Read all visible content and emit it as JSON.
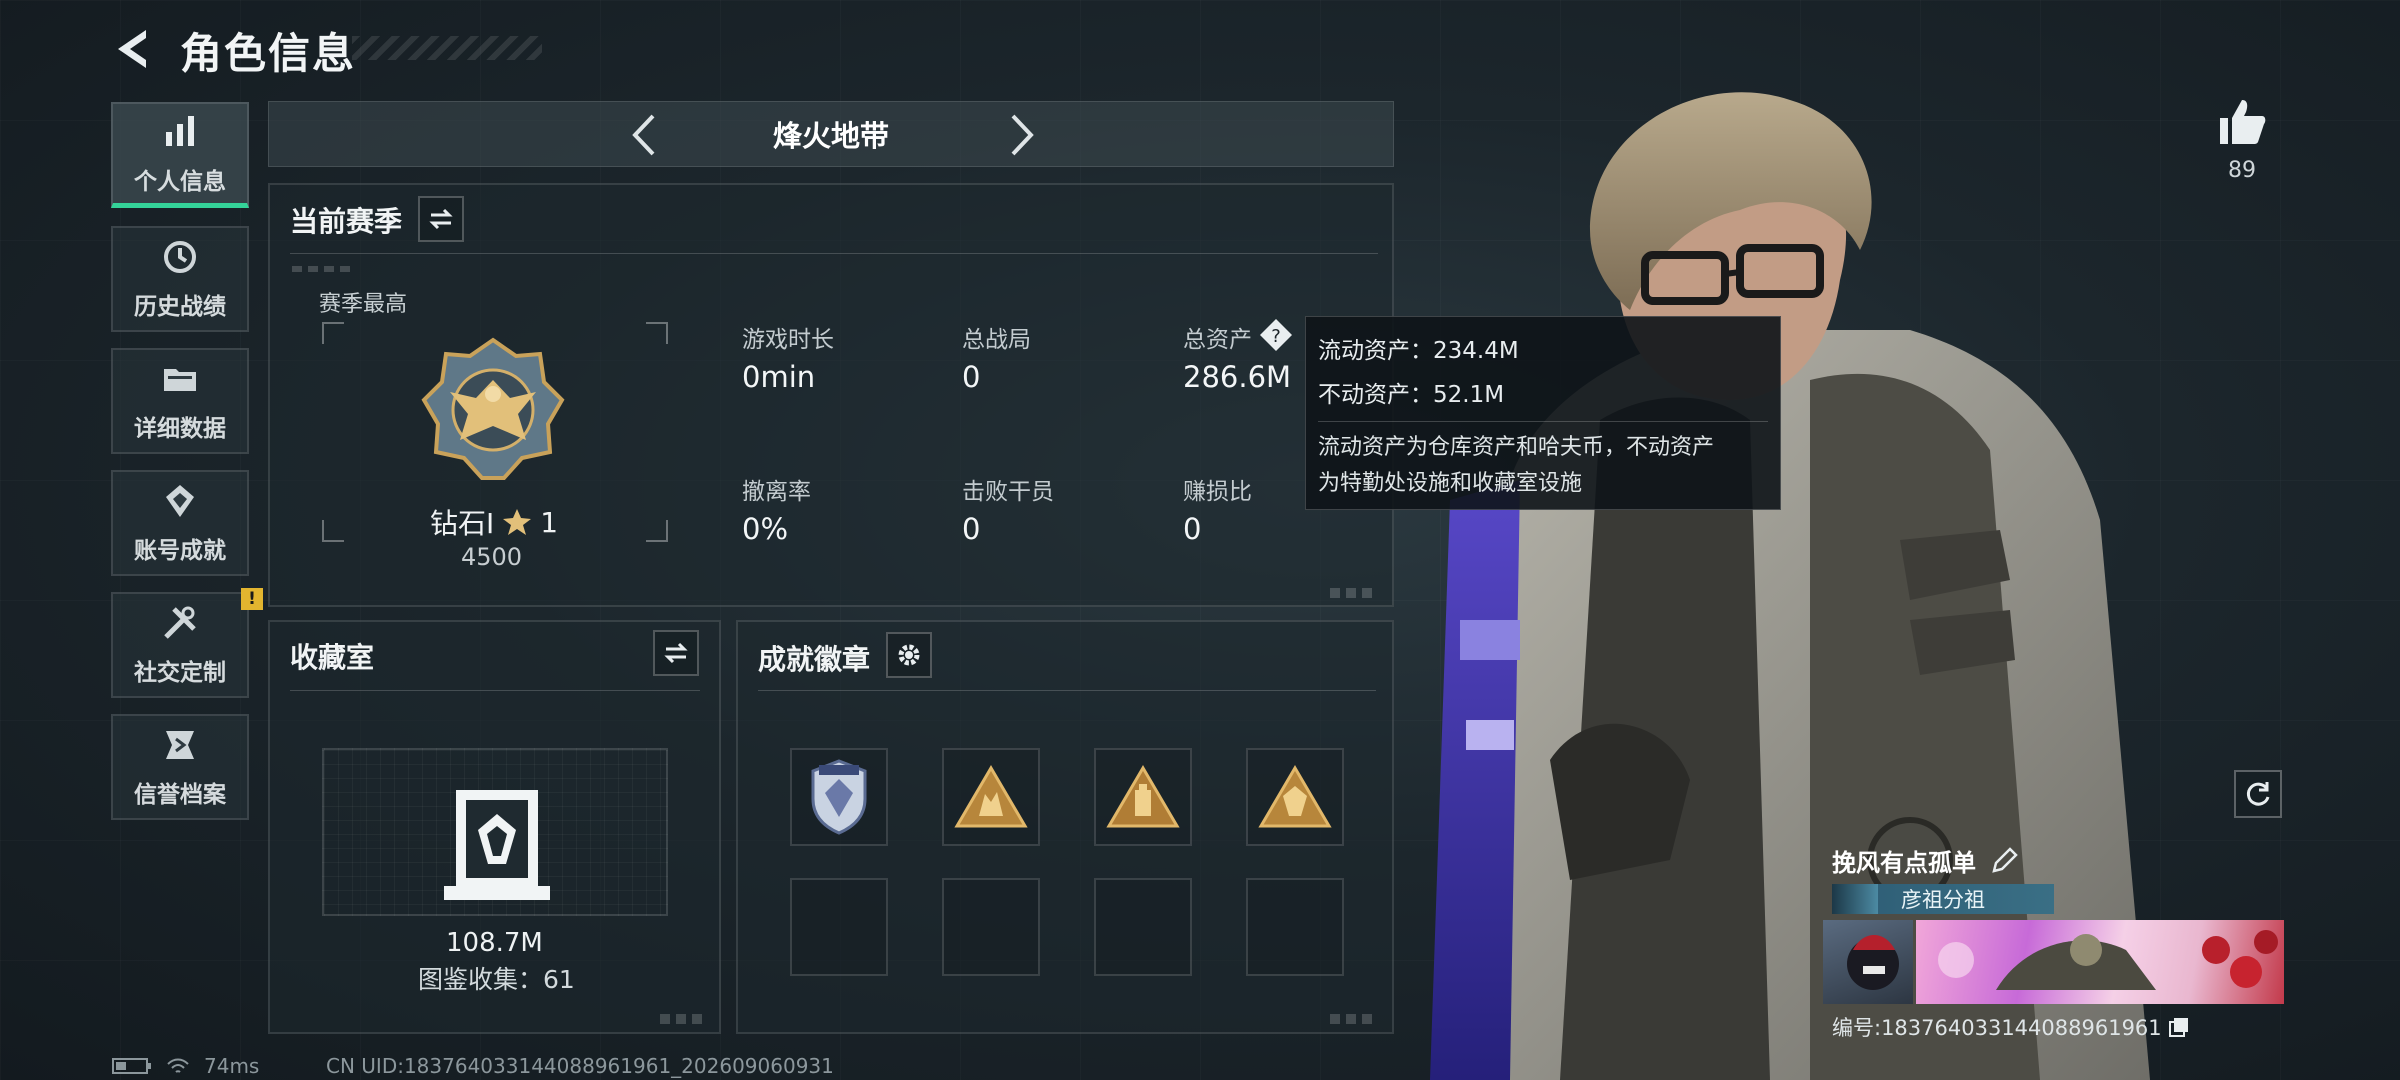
{
  "header": {
    "title": "角色信息"
  },
  "sidebar": {
    "items": [
      {
        "label": "个人信息",
        "icon": "bar-chart-icon",
        "active": true
      },
      {
        "label": "历史战绩",
        "icon": "history-icon"
      },
      {
        "label": "详细数据",
        "icon": "folder-icon"
      },
      {
        "label": "账号成就",
        "icon": "achievement-icon"
      },
      {
        "label": "社交定制",
        "icon": "tools-icon",
        "badge": "!"
      },
      {
        "label": "信誉档案",
        "icon": "credit-icon"
      }
    ]
  },
  "mode": {
    "name": "烽火地带"
  },
  "season": {
    "title": "当前赛季",
    "best_label": "赛季最高",
    "rank": "钻石Ⅰ",
    "stars": "1",
    "score": "4500",
    "stats": [
      {
        "label": "游戏时长",
        "value": "0min"
      },
      {
        "label": "总战局",
        "value": "0"
      },
      {
        "label": "总资产",
        "value": "286.6M"
      },
      {
        "label": "撤离率",
        "value": "0%"
      },
      {
        "label": "击败干员",
        "value": "0"
      },
      {
        "label": "赚损比",
        "value": "0"
      }
    ]
  },
  "tooltip": {
    "liquid": "流动资产：234.4M",
    "fixed": "不动资产：52.1M",
    "desc_line1": "流动资产为仓库资产和哈夫币，不动资产",
    "desc_line2": "为特勤处设施和收藏室设施"
  },
  "collection": {
    "title": "收藏室",
    "value": "108.7M",
    "count": "图鉴收集：61"
  },
  "achievements": {
    "title": "成就徽章"
  },
  "profile": {
    "likes": "89",
    "name": "挽风有点孤单",
    "team": "彦祖分祖",
    "id": "编号:1837640331440889619​61"
  },
  "status": {
    "ping": "74ms",
    "uid": "CN UID:1837640331440889619​61_202609060931"
  },
  "colors": {
    "accent": "#34d399",
    "badge": "#e3b52f"
  }
}
